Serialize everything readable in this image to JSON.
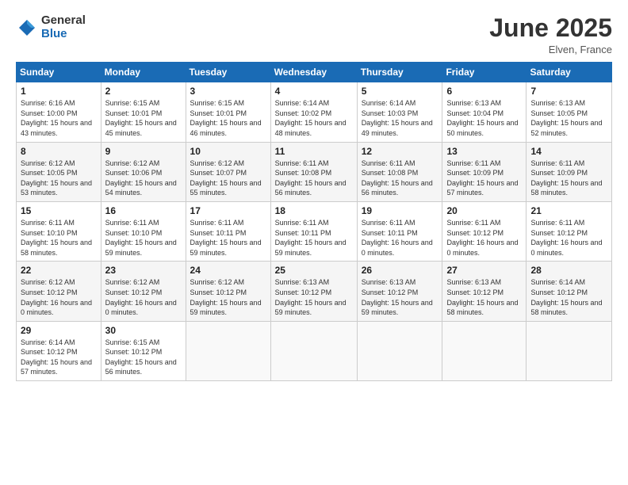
{
  "header": {
    "logo_general": "General",
    "logo_blue": "Blue",
    "month_title": "June 2025",
    "location": "Elven, France"
  },
  "days_of_week": [
    "Sunday",
    "Monday",
    "Tuesday",
    "Wednesday",
    "Thursday",
    "Friday",
    "Saturday"
  ],
  "weeks": [
    [
      {
        "day": "1",
        "sunrise": "6:16 AM",
        "sunset": "10:00 PM",
        "daylight": "15 hours and 43 minutes."
      },
      {
        "day": "2",
        "sunrise": "6:15 AM",
        "sunset": "10:01 PM",
        "daylight": "15 hours and 45 minutes."
      },
      {
        "day": "3",
        "sunrise": "6:15 AM",
        "sunset": "10:01 PM",
        "daylight": "15 hours and 46 minutes."
      },
      {
        "day": "4",
        "sunrise": "6:14 AM",
        "sunset": "10:02 PM",
        "daylight": "15 hours and 48 minutes."
      },
      {
        "day": "5",
        "sunrise": "6:14 AM",
        "sunset": "10:03 PM",
        "daylight": "15 hours and 49 minutes."
      },
      {
        "day": "6",
        "sunrise": "6:13 AM",
        "sunset": "10:04 PM",
        "daylight": "15 hours and 50 minutes."
      },
      {
        "day": "7",
        "sunrise": "6:13 AM",
        "sunset": "10:05 PM",
        "daylight": "15 hours and 52 minutes."
      }
    ],
    [
      {
        "day": "8",
        "sunrise": "6:12 AM",
        "sunset": "10:05 PM",
        "daylight": "15 hours and 53 minutes."
      },
      {
        "day": "9",
        "sunrise": "6:12 AM",
        "sunset": "10:06 PM",
        "daylight": "15 hours and 54 minutes."
      },
      {
        "day": "10",
        "sunrise": "6:12 AM",
        "sunset": "10:07 PM",
        "daylight": "15 hours and 55 minutes."
      },
      {
        "day": "11",
        "sunrise": "6:11 AM",
        "sunset": "10:08 PM",
        "daylight": "15 hours and 56 minutes."
      },
      {
        "day": "12",
        "sunrise": "6:11 AM",
        "sunset": "10:08 PM",
        "daylight": "15 hours and 56 minutes."
      },
      {
        "day": "13",
        "sunrise": "6:11 AM",
        "sunset": "10:09 PM",
        "daylight": "15 hours and 57 minutes."
      },
      {
        "day": "14",
        "sunrise": "6:11 AM",
        "sunset": "10:09 PM",
        "daylight": "15 hours and 58 minutes."
      }
    ],
    [
      {
        "day": "15",
        "sunrise": "6:11 AM",
        "sunset": "10:10 PM",
        "daylight": "15 hours and 58 minutes."
      },
      {
        "day": "16",
        "sunrise": "6:11 AM",
        "sunset": "10:10 PM",
        "daylight": "15 hours and 59 minutes."
      },
      {
        "day": "17",
        "sunrise": "6:11 AM",
        "sunset": "10:11 PM",
        "daylight": "15 hours and 59 minutes."
      },
      {
        "day": "18",
        "sunrise": "6:11 AM",
        "sunset": "10:11 PM",
        "daylight": "15 hours and 59 minutes."
      },
      {
        "day": "19",
        "sunrise": "6:11 AM",
        "sunset": "10:11 PM",
        "daylight": "16 hours and 0 minutes."
      },
      {
        "day": "20",
        "sunrise": "6:11 AM",
        "sunset": "10:12 PM",
        "daylight": "16 hours and 0 minutes."
      },
      {
        "day": "21",
        "sunrise": "6:11 AM",
        "sunset": "10:12 PM",
        "daylight": "16 hours and 0 minutes."
      }
    ],
    [
      {
        "day": "22",
        "sunrise": "6:12 AM",
        "sunset": "10:12 PM",
        "daylight": "16 hours and 0 minutes."
      },
      {
        "day": "23",
        "sunrise": "6:12 AM",
        "sunset": "10:12 PM",
        "daylight": "16 hours and 0 minutes."
      },
      {
        "day": "24",
        "sunrise": "6:12 AM",
        "sunset": "10:12 PM",
        "daylight": "15 hours and 59 minutes."
      },
      {
        "day": "25",
        "sunrise": "6:13 AM",
        "sunset": "10:12 PM",
        "daylight": "15 hours and 59 minutes."
      },
      {
        "day": "26",
        "sunrise": "6:13 AM",
        "sunset": "10:12 PM",
        "daylight": "15 hours and 59 minutes."
      },
      {
        "day": "27",
        "sunrise": "6:13 AM",
        "sunset": "10:12 PM",
        "daylight": "15 hours and 58 minutes."
      },
      {
        "day": "28",
        "sunrise": "6:14 AM",
        "sunset": "10:12 PM",
        "daylight": "15 hours and 58 minutes."
      }
    ],
    [
      {
        "day": "29",
        "sunrise": "6:14 AM",
        "sunset": "10:12 PM",
        "daylight": "15 hours and 57 minutes."
      },
      {
        "day": "30",
        "sunrise": "6:15 AM",
        "sunset": "10:12 PM",
        "daylight": "15 hours and 56 minutes."
      },
      null,
      null,
      null,
      null,
      null
    ]
  ]
}
